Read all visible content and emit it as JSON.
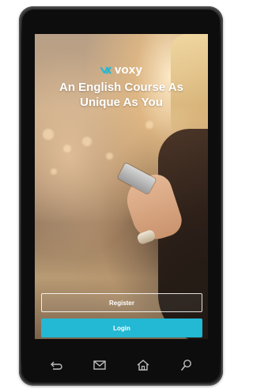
{
  "app": {
    "brand_name": "voxy",
    "brand_color": "#23b8d3"
  },
  "hero": {
    "headline_line1": "An English Course As",
    "headline_line2": "Unique As You"
  },
  "buttons": {
    "register_label": "Register",
    "login_label": "Login"
  },
  "device_nav": {
    "icons": [
      "back-icon",
      "mail-icon",
      "home-icon",
      "search-icon"
    ]
  }
}
